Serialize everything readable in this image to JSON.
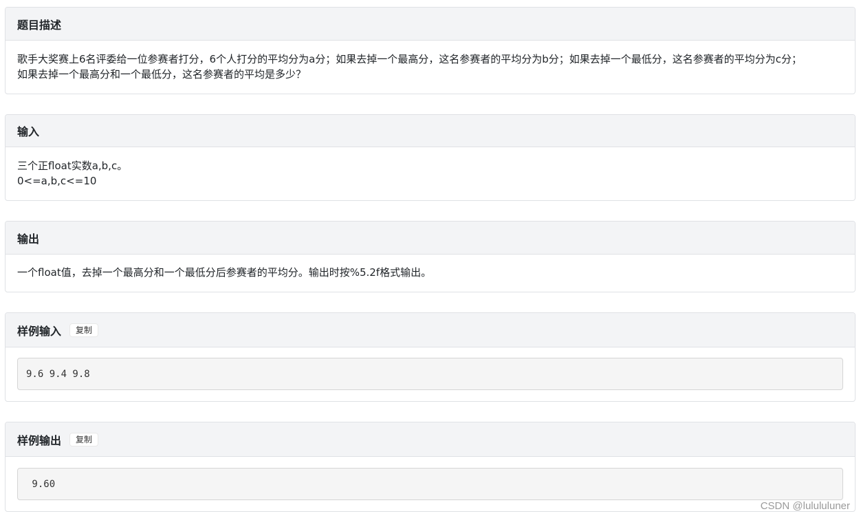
{
  "sections": {
    "description": {
      "title": "题目描述",
      "lines": [
        "歌手大奖赛上6名评委给一位参赛者打分，6个人打分的平均分为a分；如果去掉一个最高分，这名参赛者的平均分为b分；如果去掉一个最低分，这名参赛者的平均分为c分；",
        "如果去掉一个最高分和一个最低分，这名参赛者的平均是多少？"
      ]
    },
    "input": {
      "title": "输入",
      "lines": [
        "三个正float实数a,b,c。",
        "0<=a,b,c<=10"
      ]
    },
    "output": {
      "title": "输出",
      "lines": [
        "一个float值，去掉一个最高分和一个最低分后参赛者的平均分。输出时按%5.2f格式输出。"
      ]
    },
    "sample_input": {
      "title": "样例输入",
      "copy_label": "复制",
      "code": "9.6 9.4 9.8"
    },
    "sample_output": {
      "title": "样例输出",
      "copy_label": "复制",
      "code": " 9.60"
    }
  },
  "watermark": "CSDN @lulululuner"
}
